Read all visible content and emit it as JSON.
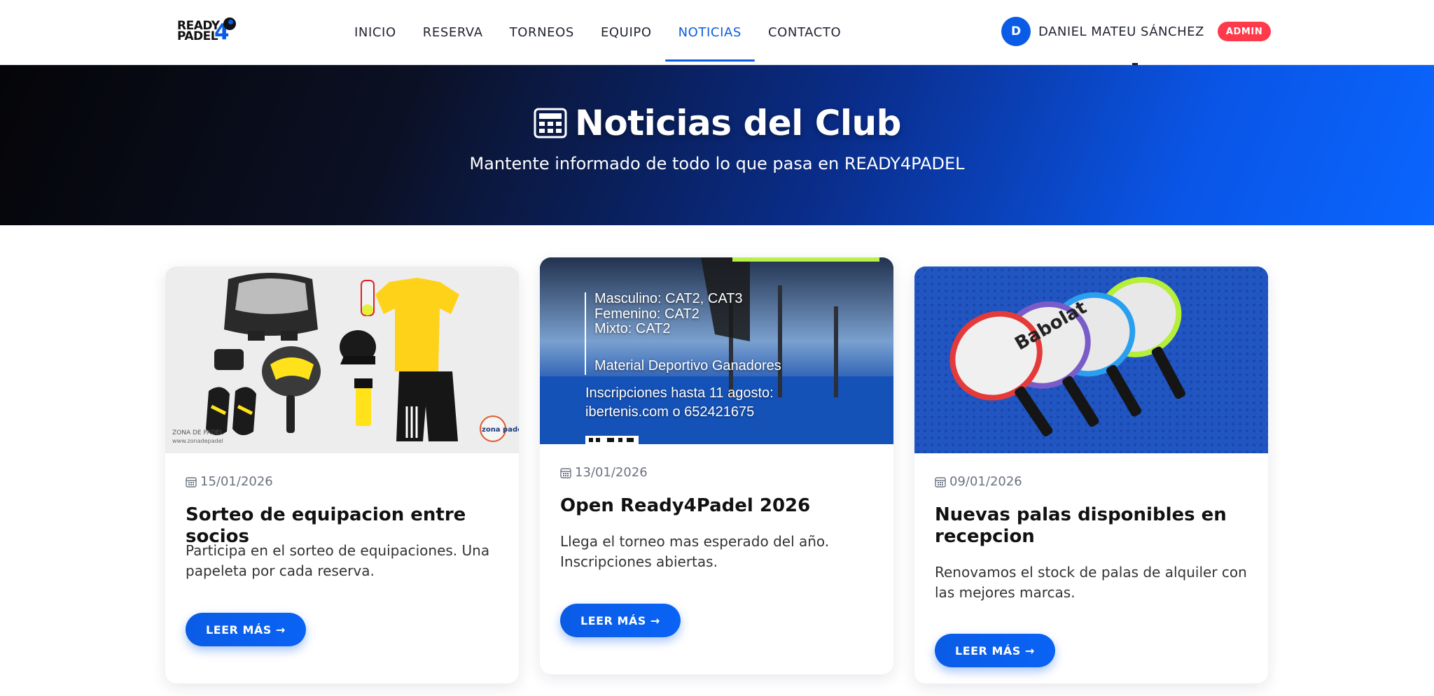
{
  "brand": {
    "line1": "READY",
    "line2": "PADEL",
    "number": "4"
  },
  "nav": {
    "items": [
      {
        "label": "INICIO"
      },
      {
        "label": "RESERVA"
      },
      {
        "label": "TORNEOS"
      },
      {
        "label": "EQUIPO"
      },
      {
        "label": "NOTICIAS",
        "active": true
      },
      {
        "label": "CONTACTO"
      }
    ]
  },
  "user": {
    "initial": "D",
    "name": "DANIEL MATEU SÁNCHEZ",
    "role_badge": "ADMIN"
  },
  "hero": {
    "title": "Noticias del Club",
    "subtitle": "Mantente informado de todo lo que pasa en READY4PADEL",
    "icon": "newspaper-icon"
  },
  "news": [
    {
      "date": "15/01/2026",
      "title": "Sorteo de equipacion entre socios",
      "excerpt": "Participa en el sorteo de equipaciones. Una papeleta por cada reserva.",
      "button": "LEER MÁS →",
      "image": {
        "corner_text_1": "ZONA DE PADEL",
        "corner_text_2": "www.zonadepadel",
        "logo_text": "zona padel"
      }
    },
    {
      "date": "13/01/2026",
      "title": "Open Ready4Padel 2026",
      "excerpt": "Llega el torneo mas esperado del año. Inscripciones abiertas.",
      "button": "LEER MÁS →",
      "image": {
        "line1": "Masculino: CAT2, CAT3",
        "line2": "Femenino: CAT2",
        "line3": "Mixto: CAT2",
        "line4": "Material Deportivo Ganadores",
        "line5": "Inscripciones hasta 11 agosto:",
        "line6": "ibertenis.com o 652421675"
      }
    },
    {
      "date": "09/01/2026",
      "title": "Nuevas palas disponibles en recepcion",
      "excerpt": "Renovamos el stock de palas de alquiler con las mejores marcas.",
      "button": "LEER MÁS →",
      "image": {
        "racket_brand": "Babolat"
      }
    }
  ],
  "colors": {
    "accent": "#0a5ce6",
    "badge": "#ff3b4b",
    "hero_dark": "#050508",
    "hero_blue": "#0a66ff"
  }
}
